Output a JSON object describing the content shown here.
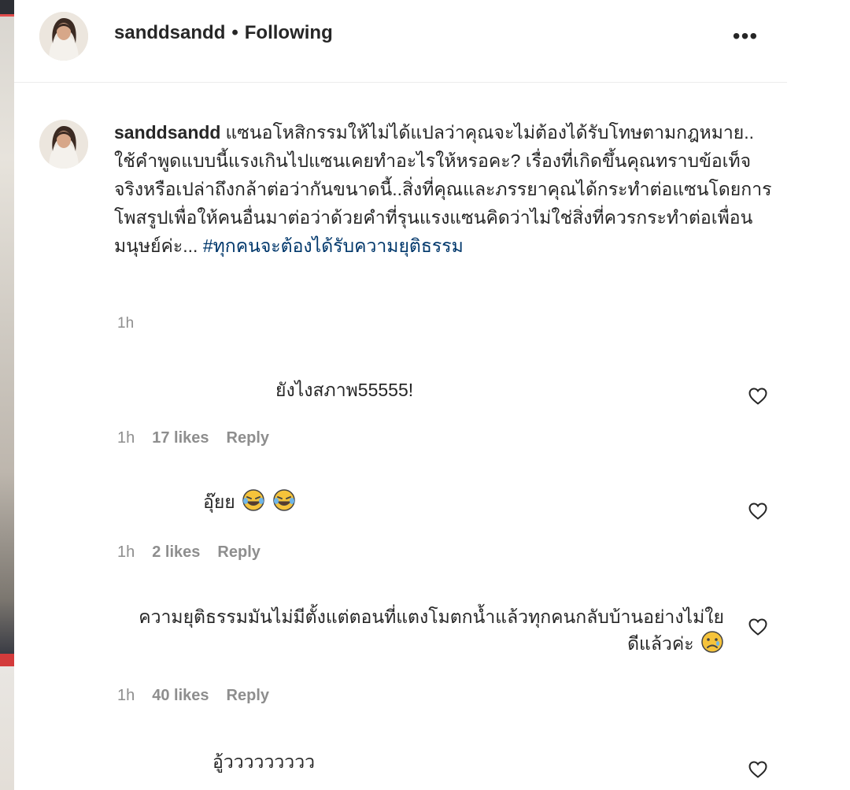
{
  "post": {
    "username": "sanddsandd",
    "separator": "•",
    "follow_status": "Following",
    "more_label": "•••"
  },
  "caption": {
    "username": "sanddsandd",
    "text": "แซนอโหสิกรรมให้ไม่ได้แปลว่าคุณจะไม่ต้องได้รับโทษตามกฎหมาย.. ใช้คำพูดแบบนี้แรงเกินไปแซนเคยทำอะไรให้หรอคะ? เรื่องที่เกิดขึ้นคุณทราบข้อเท็จจริงหรือเปล่าถึงกล้าต่อว่ากันขนาดนี้..สิ่งที่คุณและภรรยาคุณได้กระทำต่อแซนโดยการโพสรูปเพื่อให้คนอื่นมาต่อว่าด้วยคำที่รุนแรงแซนคิดว่าไม่ใช่สิ่งที่ควรกระทำต่อเพื่อนมนุษย์ค่ะ...",
    "hashtag": "#ทุกคนจะต้องได้รับความยุติธรรม",
    "time": "1h"
  },
  "comments": [
    {
      "text": "ยังไงสภาพ55555!",
      "time": "1h",
      "likes": "17 likes",
      "reply": "Reply",
      "emoji": []
    },
    {
      "text": "อุ๊ยย",
      "time": "1h",
      "likes": "2 likes",
      "reply": "Reply",
      "emoji": [
        "laughing-tears-emoji",
        "laughing-tears-emoji"
      ]
    },
    {
      "text": "ความยุติธรรมมันไม่มีตั้งแต่ตอนที่แตงโมตกน้ำแล้วทุกคนกลับบ้านอย่างไม่ใยดีแล้วค่ะ",
      "time": "1h",
      "likes": "40 likes",
      "reply": "Reply",
      "emoji": [
        "sad-face-emoji"
      ]
    },
    {
      "text": "อู้ววววววววว",
      "emoji": []
    }
  ],
  "icons": {
    "more": "more-options-icon",
    "like": "heart-outline-icon"
  },
  "colors": {
    "text": "#262626",
    "secondary": "#8e8e8e",
    "hashtag": "#00376b",
    "divider": "#ececec"
  }
}
